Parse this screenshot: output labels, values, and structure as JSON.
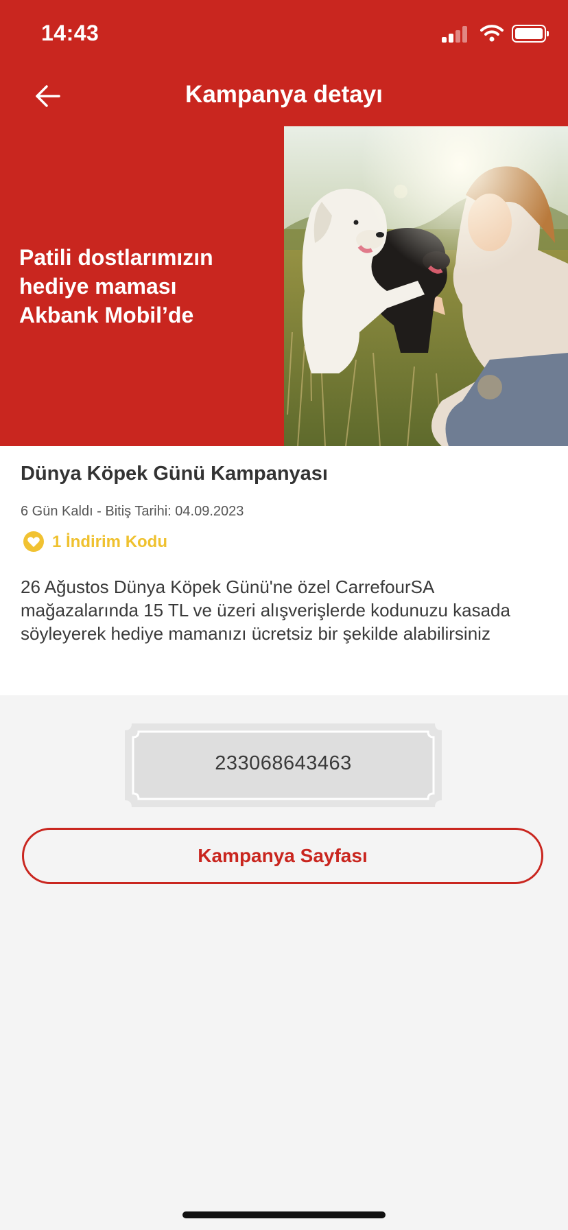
{
  "status_bar": {
    "time": "14:43",
    "icons": [
      "cellular-signal-icon",
      "wifi-icon",
      "battery-icon"
    ]
  },
  "header": {
    "title": "Kampanya detayı",
    "back_icon": "arrow-left-icon"
  },
  "banner": {
    "headline_line1": "Patili dostlarımızın",
    "headline_line2": "hediye maması",
    "headline_line3": "Akbank Mobil’de",
    "photo_subject": "woman-with-two-dogs-photo"
  },
  "campaign": {
    "title": "Dünya Köpek Günü Kampanyası",
    "deadline": "6 Gün Kaldı - Bitiş Tarihi: 04.09.2023",
    "code_count_label": "1 İndirim Kodu",
    "description": "26 Ağustos Dünya Köpek Günü'ne özel CarrefourSA mağazalarında 15 TL ve üzeri alışverişlerde kodunuzu kasada söyleyerek hediye mamanızı ücretsiz bir şekilde alabilirsiniz"
  },
  "coupon": {
    "code": "233068643463"
  },
  "actions": {
    "campaign_page_label": "Kampanya Sayfası"
  },
  "colors": {
    "brand_red": "#c9261f",
    "accent_yellow": "#efc12f",
    "background": "#f4f4f4"
  }
}
